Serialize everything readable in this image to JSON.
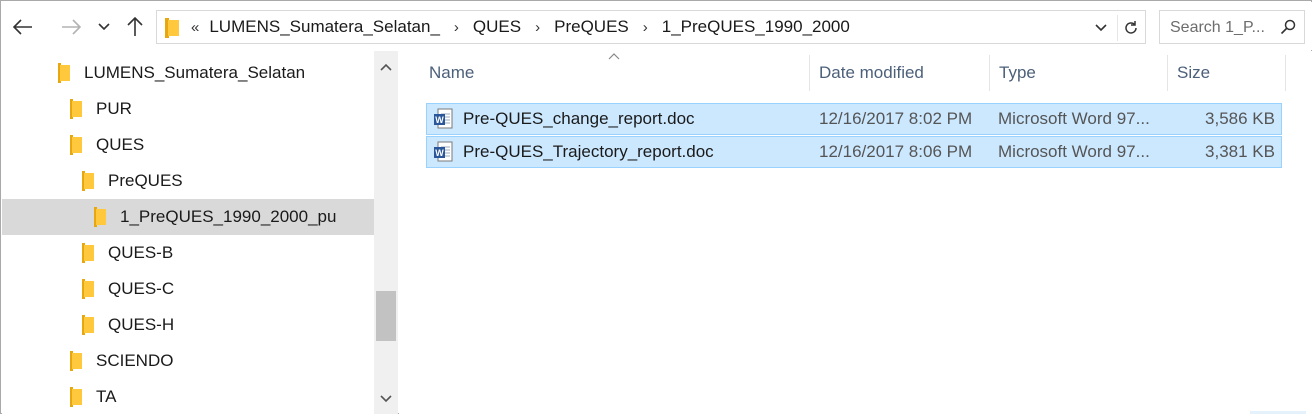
{
  "toolbar": {
    "back_icon": "arrow-left-icon",
    "forward_icon": "arrow-right-icon",
    "recent_icon": "chevron-down-icon",
    "up_icon": "arrow-up-icon"
  },
  "address": {
    "overflow": "«",
    "breadcrumbs": [
      "LUMENS_Sumatera_Selatan_",
      "QUES",
      "PreQUES",
      "1_PreQUES_1990_2000"
    ],
    "separator": "›"
  },
  "search": {
    "placeholder": "Search 1_P..."
  },
  "nav": {
    "items": [
      {
        "label": "LUMENS_Sumatera_Selatan",
        "level": 0,
        "selected": false
      },
      {
        "label": "PUR",
        "level": 1,
        "selected": false
      },
      {
        "label": "QUES",
        "level": 1,
        "selected": false
      },
      {
        "label": "PreQUES",
        "level": 2,
        "selected": false
      },
      {
        "label": "1_PreQUES_1990_2000_pu",
        "level": 3,
        "selected": true
      },
      {
        "label": "QUES-B",
        "level": 2,
        "selected": false
      },
      {
        "label": "QUES-C",
        "level": 2,
        "selected": false
      },
      {
        "label": "QUES-H",
        "level": 2,
        "selected": false
      },
      {
        "label": "SCIENDO",
        "level": 1,
        "selected": false
      },
      {
        "label": "TA",
        "level": 1,
        "selected": false
      }
    ]
  },
  "list": {
    "columns": {
      "name": "Name",
      "date": "Date modified",
      "type": "Type",
      "size": "Size"
    },
    "files": [
      {
        "name": "Pre-QUES_change_report.doc",
        "date": "12/16/2017 8:02 PM",
        "type": "Microsoft Word 97...",
        "size": "3,586 KB",
        "selected": true
      },
      {
        "name": "Pre-QUES_Trajectory_report.doc",
        "date": "12/16/2017 8:06 PM",
        "type": "Microsoft Word 97...",
        "size": "3,381 KB",
        "selected": true
      }
    ]
  },
  "colors": {
    "selection_bg": "#cce8ff",
    "selection_border": "#99d1ff",
    "folder": "#ffc83d",
    "header_text": "#4c607a",
    "word_blue": "#2b579a"
  }
}
